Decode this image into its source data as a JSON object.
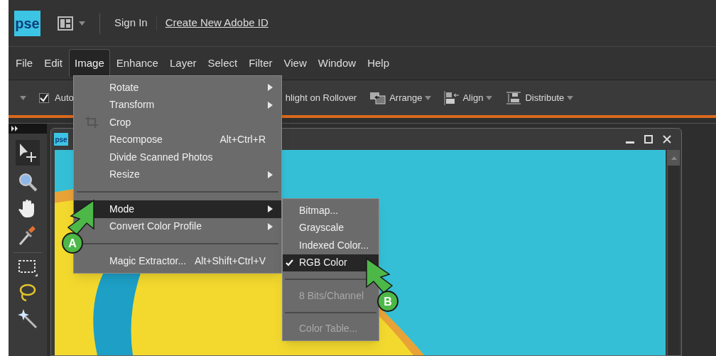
{
  "top_bar": {
    "logo": "pse",
    "sign_in": "Sign In",
    "create_id": "Create New Adobe ID"
  },
  "menu_bar": [
    {
      "label": "File",
      "selected": false
    },
    {
      "label": "Edit",
      "selected": false
    },
    {
      "label": "Image",
      "selected": true
    },
    {
      "label": "Enhance",
      "selected": false
    },
    {
      "label": "Layer",
      "selected": false
    },
    {
      "label": "Select",
      "selected": false
    },
    {
      "label": "Filter",
      "selected": false
    },
    {
      "label": "View",
      "selected": false
    },
    {
      "label": "Window",
      "selected": false
    },
    {
      "label": "Help",
      "selected": false
    }
  ],
  "options_bar": {
    "auto": {
      "label": "Auto",
      "checked": true
    },
    "highlight_label": "hlight on Rollover",
    "buttons": [
      {
        "kind": "arrange",
        "label": "Arrange"
      },
      {
        "kind": "align",
        "label": "Align"
      },
      {
        "kind": "distribute",
        "label": "Distribute"
      }
    ]
  },
  "document": {
    "logo": "pse"
  },
  "image_menu": [
    {
      "kind": "item",
      "label": "Rotate",
      "submenu": true,
      "highlighted": false
    },
    {
      "kind": "item",
      "label": "Transform",
      "submenu": true,
      "highlighted": false
    },
    {
      "kind": "item",
      "label": "Crop",
      "icon": true,
      "submenu": false,
      "highlighted": false
    },
    {
      "kind": "item",
      "label": "Recompose",
      "shortcut": "Alt+Ctrl+R",
      "submenu": false,
      "highlighted": false
    },
    {
      "kind": "item",
      "label": "Divide Scanned Photos",
      "submenu": false,
      "highlighted": false
    },
    {
      "kind": "item",
      "label": "Resize",
      "submenu": true,
      "highlighted": false
    },
    {
      "kind": "separator"
    },
    {
      "kind": "item",
      "label": "Mode",
      "submenu": true,
      "highlighted": true
    },
    {
      "kind": "item",
      "label": "Convert Color Profile",
      "submenu": true,
      "highlighted": false
    },
    {
      "kind": "separator"
    },
    {
      "kind": "item",
      "label": "Magic Extractor...",
      "shortcut": "Alt+Shift+Ctrl+V",
      "submenu": false,
      "highlighted": false
    }
  ],
  "mode_menu": [
    {
      "kind": "item",
      "label": "Bitmap...",
      "checked": false,
      "highlighted": false,
      "disabled": false
    },
    {
      "kind": "item",
      "label": "Grayscale",
      "checked": false,
      "highlighted": false,
      "disabled": false
    },
    {
      "kind": "item",
      "label": "Indexed Color...",
      "checked": false,
      "highlighted": false,
      "disabled": false
    },
    {
      "kind": "item",
      "label": "RGB Color",
      "checked": true,
      "highlighted": true,
      "disabled": false
    },
    {
      "kind": "separator"
    },
    {
      "kind": "item",
      "label": "8 Bits/Channel",
      "checked": false,
      "highlighted": false,
      "disabled": true
    },
    {
      "kind": "separator"
    },
    {
      "kind": "item",
      "label": "Color Table...",
      "checked": false,
      "highlighted": false,
      "disabled": true
    }
  ],
  "callouts": [
    "A",
    "B"
  ]
}
